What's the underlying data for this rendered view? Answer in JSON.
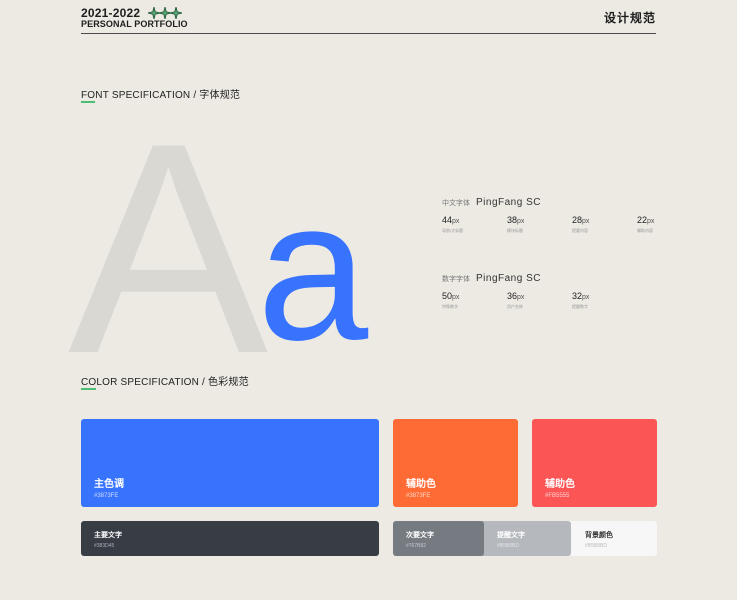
{
  "header": {
    "year": "2021-2022",
    "subtitle": "PERSONAL PORTFOLIO",
    "right_title": "设计规范"
  },
  "font_section": {
    "title_underlined": "FO",
    "title_rest": "NT SPECIFICATION / 字体规范",
    "big_A": "A",
    "big_a": "a",
    "chinese": {
      "label": "中文字体",
      "name": "PingFang SC",
      "sizes": [
        {
          "value": "44",
          "unit": "px",
          "desc": "导航/大标题"
        },
        {
          "value": "38",
          "unit": "px",
          "desc": "模块标题"
        },
        {
          "value": "28",
          "unit": "px",
          "desc": "提要内容"
        },
        {
          "value": "22",
          "unit": "px",
          "desc": "辅助内容"
        }
      ]
    },
    "number": {
      "label": "数字字体",
      "name": "PingFang SC",
      "sizes": [
        {
          "value": "50",
          "unit": "px",
          "desc": "特殊数字"
        },
        {
          "value": "36",
          "unit": "px",
          "desc": "用户名称"
        },
        {
          "value": "32",
          "unit": "px",
          "desc": "提醒数字"
        }
      ]
    }
  },
  "color_section": {
    "title_underlined": "CO",
    "title_rest": "LOR SPECIFICATION / 色彩规范",
    "main": {
      "name": "主色调",
      "hex": "#3873FE",
      "color": "#3873fe"
    },
    "aux1": {
      "name": "辅助色",
      "hex": "#3873FE",
      "color": "#ff6b35"
    },
    "aux2": {
      "name": "辅助色",
      "hex": "#FB5555",
      "color": "#fb5555"
    },
    "text_primary": {
      "name": "主要文字",
      "hex": "#383D45",
      "color": "#383d45"
    },
    "text_secondary": {
      "name": "次要文字",
      "hex": "#767B82",
      "color": "#767b82"
    },
    "text_hint": {
      "name": "提醒文字",
      "hex": "#B5B8BD",
      "color": "#b5b8bd"
    },
    "background": {
      "name": "背景颜色",
      "hex": "#B5B8BD",
      "color": "#f7f7f7"
    }
  },
  "colors": {
    "accent_star": "#2e8b57",
    "underline": "#4dbf74"
  }
}
